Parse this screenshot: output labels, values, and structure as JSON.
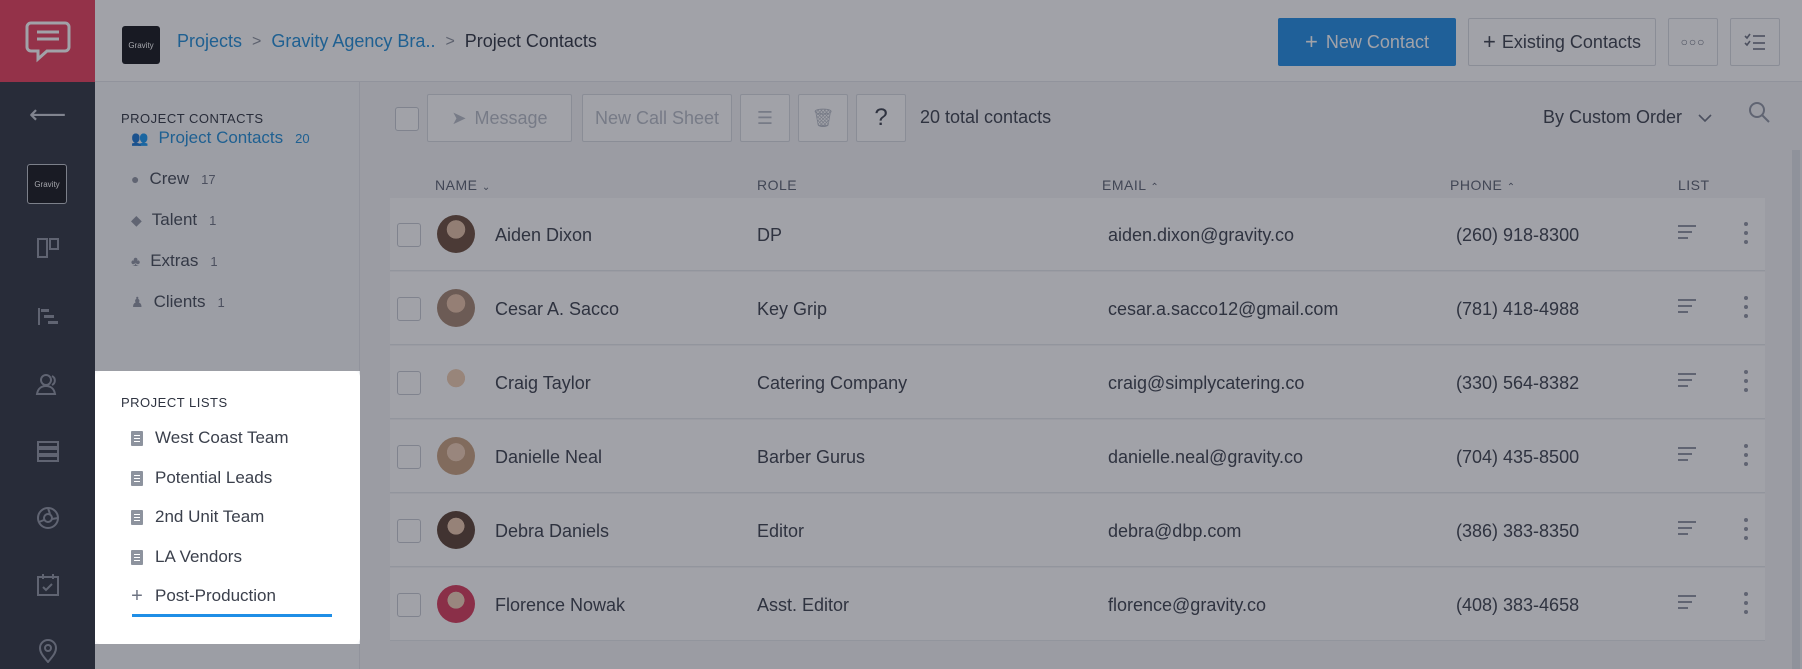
{
  "rail": {
    "items": [
      {
        "icon": "chat-bubble-logo-icon"
      },
      {
        "icon": "back-arrow-icon"
      },
      {
        "icon": "project-thumbnail",
        "label": "Gravity"
      },
      {
        "icon": "board-icon"
      },
      {
        "icon": "timeline-icon"
      },
      {
        "icon": "contacts-icon"
      },
      {
        "icon": "list-icon"
      },
      {
        "icon": "aperture-icon"
      },
      {
        "icon": "calendar-check-icon"
      },
      {
        "icon": "location-pin-icon"
      }
    ]
  },
  "header": {
    "thumb_label": "Gravity",
    "breadcrumb": [
      "Projects",
      "Gravity Agency Bra..",
      "Project Contacts"
    ],
    "new_contact": "New Contact",
    "existing_contacts": "Existing Contacts"
  },
  "subnav": {
    "title": "PROJECT CONTACTS",
    "items": [
      {
        "label": "Project Contacts",
        "count": "20",
        "active": true
      },
      {
        "label": "Crew",
        "count": "17"
      },
      {
        "label": "Talent",
        "count": "1"
      },
      {
        "label": "Extras",
        "count": "1"
      },
      {
        "label": "Clients",
        "count": "1"
      }
    ]
  },
  "lists": {
    "title": "PROJECT LISTS",
    "items": [
      "West Coast Team",
      "Potential Leads",
      "2nd Unit Team",
      "LA Vendors"
    ],
    "new_item": "Post-Production"
  },
  "toolbar": {
    "message": "Message",
    "call_sheet": "New Call Sheet",
    "help": "?",
    "total": "20 total contacts",
    "sort": "By Custom Order"
  },
  "table": {
    "headers": {
      "name": "NAME",
      "role": "ROLE",
      "email": "EMAIL",
      "phone": "PHONE",
      "list": "LIST"
    },
    "rows": [
      {
        "name": "Aiden Dixon",
        "role": "DP",
        "email": "aiden.dixon@gravity.co",
        "phone": "(260) 918-8300"
      },
      {
        "name": "Cesar A. Sacco",
        "role": "Key Grip",
        "email": "cesar.a.sacco12@gmail.com",
        "phone": "(781) 418-4988"
      },
      {
        "name": "Craig Taylor",
        "role": "Catering Company",
        "email": "craig@simplycatering.co",
        "phone": "(330) 564-8382"
      },
      {
        "name": "Danielle Neal",
        "role": "Barber Gurus",
        "email": "danielle.neal@gravity.co",
        "phone": "(704) 435-8500"
      },
      {
        "name": "Debra Daniels",
        "role": "Editor",
        "email": "debra@dbp.com",
        "phone": "(386) 383-8350"
      },
      {
        "name": "Florence Nowak",
        "role": "Asst. Editor",
        "email": "florence@gravity.co",
        "phone": "(408) 383-4658"
      }
    ]
  },
  "colors": {
    "accent": "#1f8ee6",
    "brand": "#e83e5c",
    "rail": "#2f3441"
  }
}
